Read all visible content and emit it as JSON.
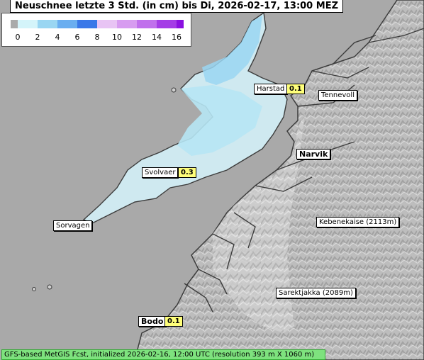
{
  "title": "Neuschnee letzte 3 Std. (in cm) bis Di, 2026-02-17, 13:00 MEZ",
  "legend": {
    "ticks": [
      "0",
      "2",
      "4",
      "6",
      "8",
      "10",
      "12",
      "14",
      "16"
    ],
    "colors": [
      "#aaaaaa",
      "#d4f4fa",
      "#9ad6f2",
      "#6aaef0",
      "#3a78e8",
      "#e8c4f4",
      "#d79cf0",
      "#c070ec",
      "#a43ce6",
      "#8a10e0"
    ]
  },
  "places": [
    {
      "name": "Harstad",
      "value": "0.1"
    },
    {
      "name": "Tennevoll"
    },
    {
      "name": "Narvik"
    },
    {
      "name": "Svolvaer",
      "value": "0.3"
    },
    {
      "name": "Sorvagen"
    },
    {
      "name": "Kebenekaise (2113m)"
    },
    {
      "name": "Sarektjakka (2089m)"
    },
    {
      "name": "Bodo",
      "value": "0.1"
    }
  ],
  "footer": "GFS-based MetGIS Fcst, initialized 2026-02-16, 12:00 UTC  (resolution 393 m X 1060 m)"
}
